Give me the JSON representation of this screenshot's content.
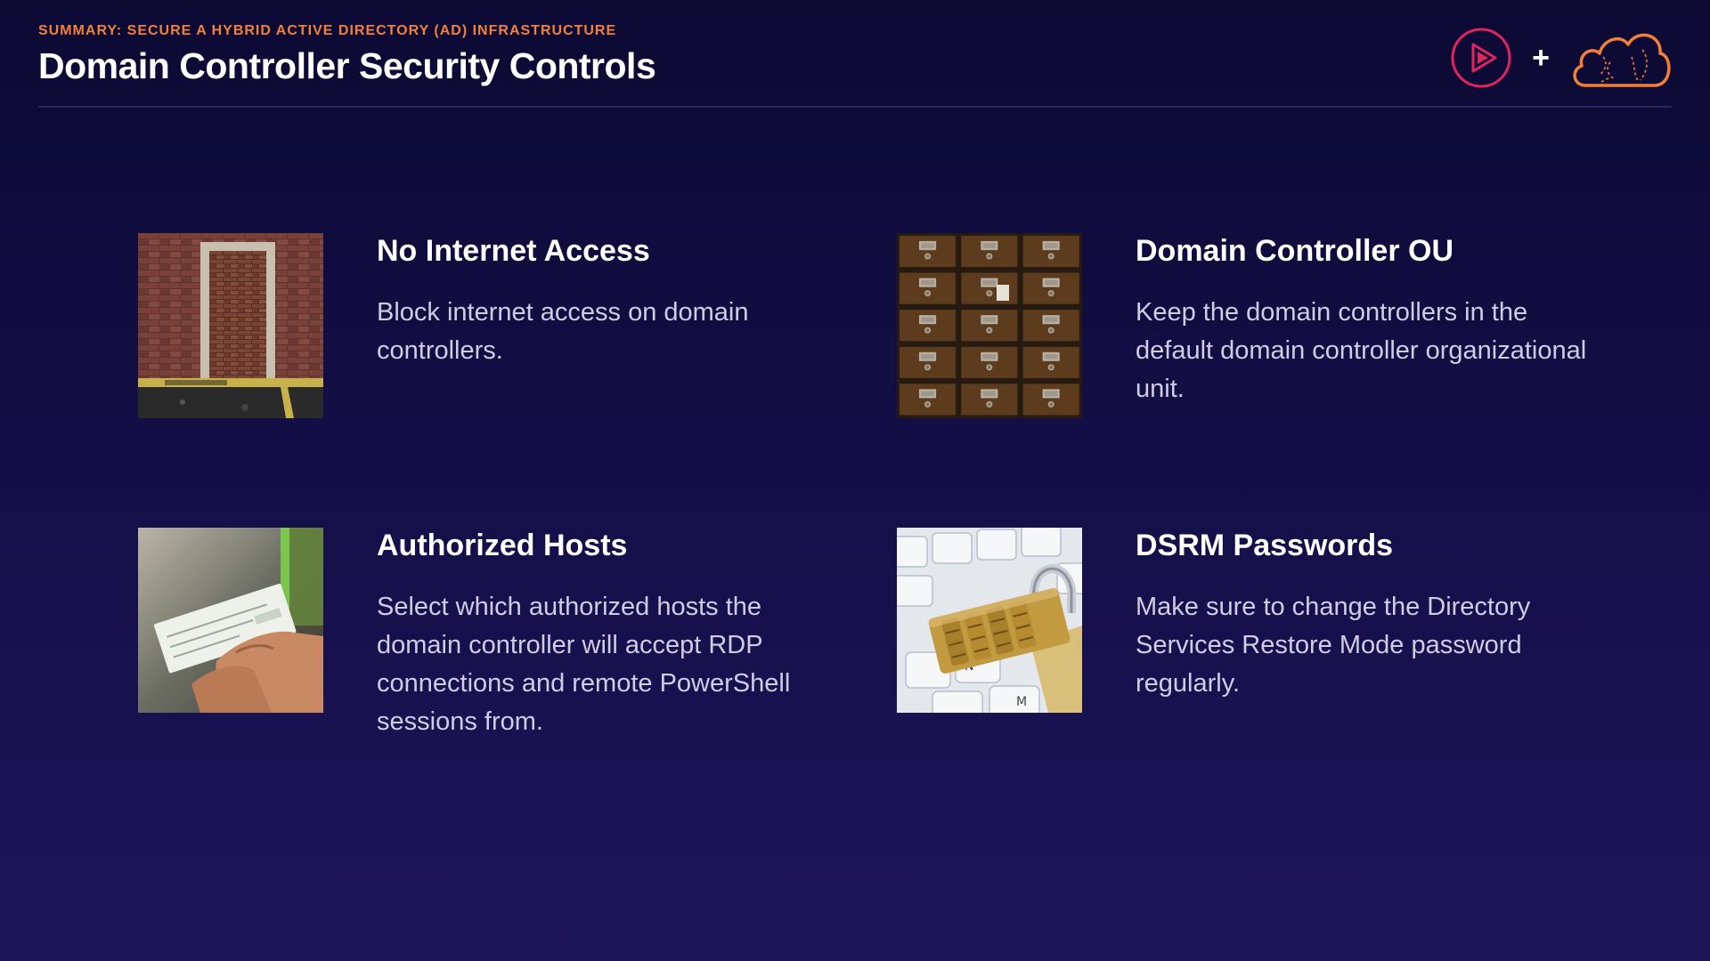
{
  "header": {
    "eyebrow": "SUMMARY: SECURE A HYBRID ACTIVE DIRECTORY (AD) INFRASTRUCTURE",
    "title": "Domain Controller Security Controls",
    "plus": "+"
  },
  "logos": {
    "left": "play-logo-icon",
    "right": "cloud-logo-icon",
    "colors": {
      "play": "#e0245e",
      "cloud": "#f2803a"
    }
  },
  "colors": {
    "background": "#140e45",
    "accent": "#f2803a",
    "body_text": "#d0cce4"
  },
  "cards": [
    {
      "image": "brick-doorway-image",
      "title": "No Internet Access",
      "description": "Block internet access on domain controllers."
    },
    {
      "image": "card-catalog-image",
      "title": "Domain Controller OU",
      "description": "Keep the domain controllers in the default domain controller organizational unit."
    },
    {
      "image": "handing-check-image",
      "title": "Authorized Hosts",
      "description": "Select which authorized hosts the domain controller will accept RDP connections and remote PowerShell sessions from."
    },
    {
      "image": "padlock-keyboard-image",
      "title": "DSRM Passwords",
      "description": "Make sure to change the Directory Services Restore Mode password regularly."
    }
  ]
}
